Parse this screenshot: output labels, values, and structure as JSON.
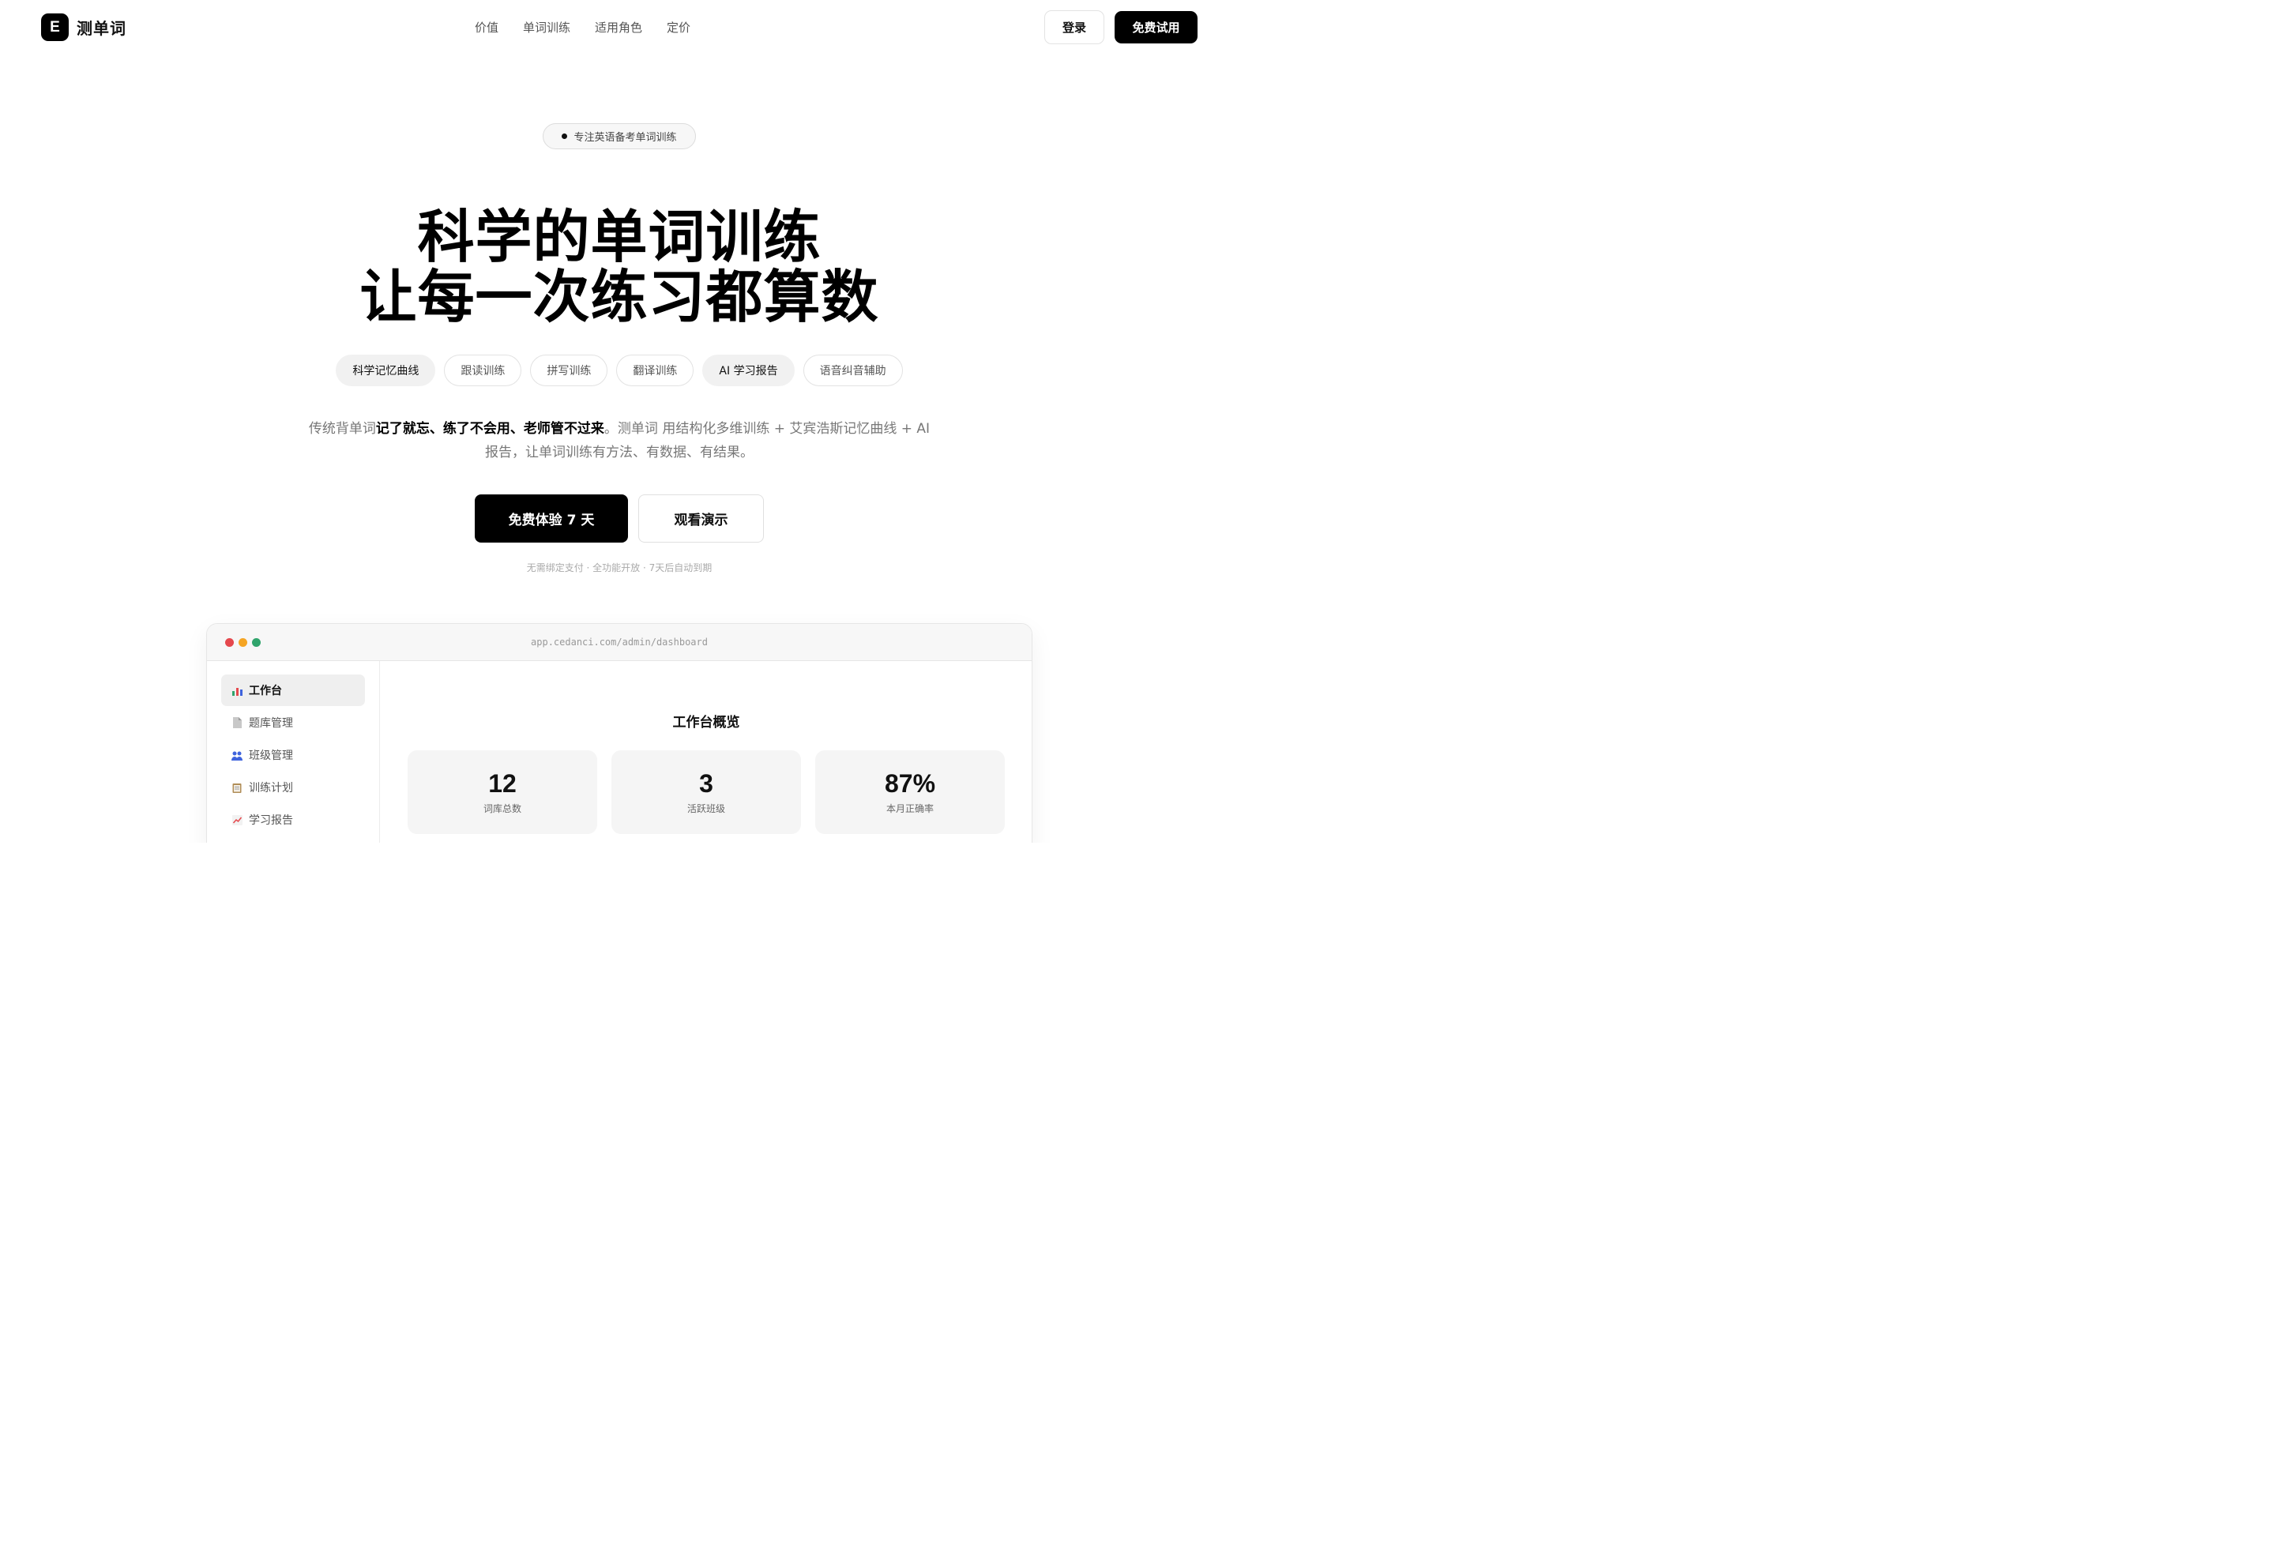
{
  "brand": {
    "logo_letter": "E",
    "name": "测单词"
  },
  "nav": {
    "items": [
      "价值",
      "单词训练",
      "适用角色",
      "定价"
    ]
  },
  "header_actions": {
    "login": "登录",
    "free_trial": "免费试用"
  },
  "hero": {
    "badge": "专注英语备考单词训练",
    "title_line1": "科学的单词训练",
    "title_line2": "让每一次练习都算数",
    "chips": [
      "科学记忆曲线",
      "跟读训练",
      "拼写训练",
      "翻译训练",
      "AI 学习报告",
      "语音纠音辅助"
    ],
    "desc_part1": "传统背单词",
    "desc_bold": "记了就忘、练了不会用、老师管不过来",
    "desc_part2": "。测单词 用结构化多维训练 + 艾宾浩斯记忆曲线 + AI 报告，让单词训练有方法、有数据、有结果。",
    "cta_primary": "免费体验 7 天",
    "cta_secondary": "观看演示",
    "cta_note": "无需绑定支付 · 全功能开放 · 7天后自动到期"
  },
  "preview": {
    "url": "app.cedanci.com/admin/dashboard",
    "dot_colors": [
      "#e5484d",
      "#f5a524",
      "#30a46c"
    ],
    "sidebar": [
      {
        "icon": "bar-chart-icon",
        "label": "工作台"
      },
      {
        "icon": "document-icon",
        "label": "题库管理"
      },
      {
        "icon": "people-icon",
        "label": "班级管理"
      },
      {
        "icon": "clipboard-icon",
        "label": "训练计划"
      },
      {
        "icon": "trend-chart-icon",
        "label": "学习报告"
      }
    ],
    "main_title": "工作台概览",
    "stats": [
      {
        "value": "12",
        "label": "词库总数"
      },
      {
        "value": "3",
        "label": "活跃班级"
      },
      {
        "value": "87%",
        "label": "本月正确率"
      }
    ]
  },
  "colors": {
    "primary": "#000000",
    "chip_active_bg": "#f1f1f1",
    "stat_card_bg": "#f5f5f5"
  }
}
